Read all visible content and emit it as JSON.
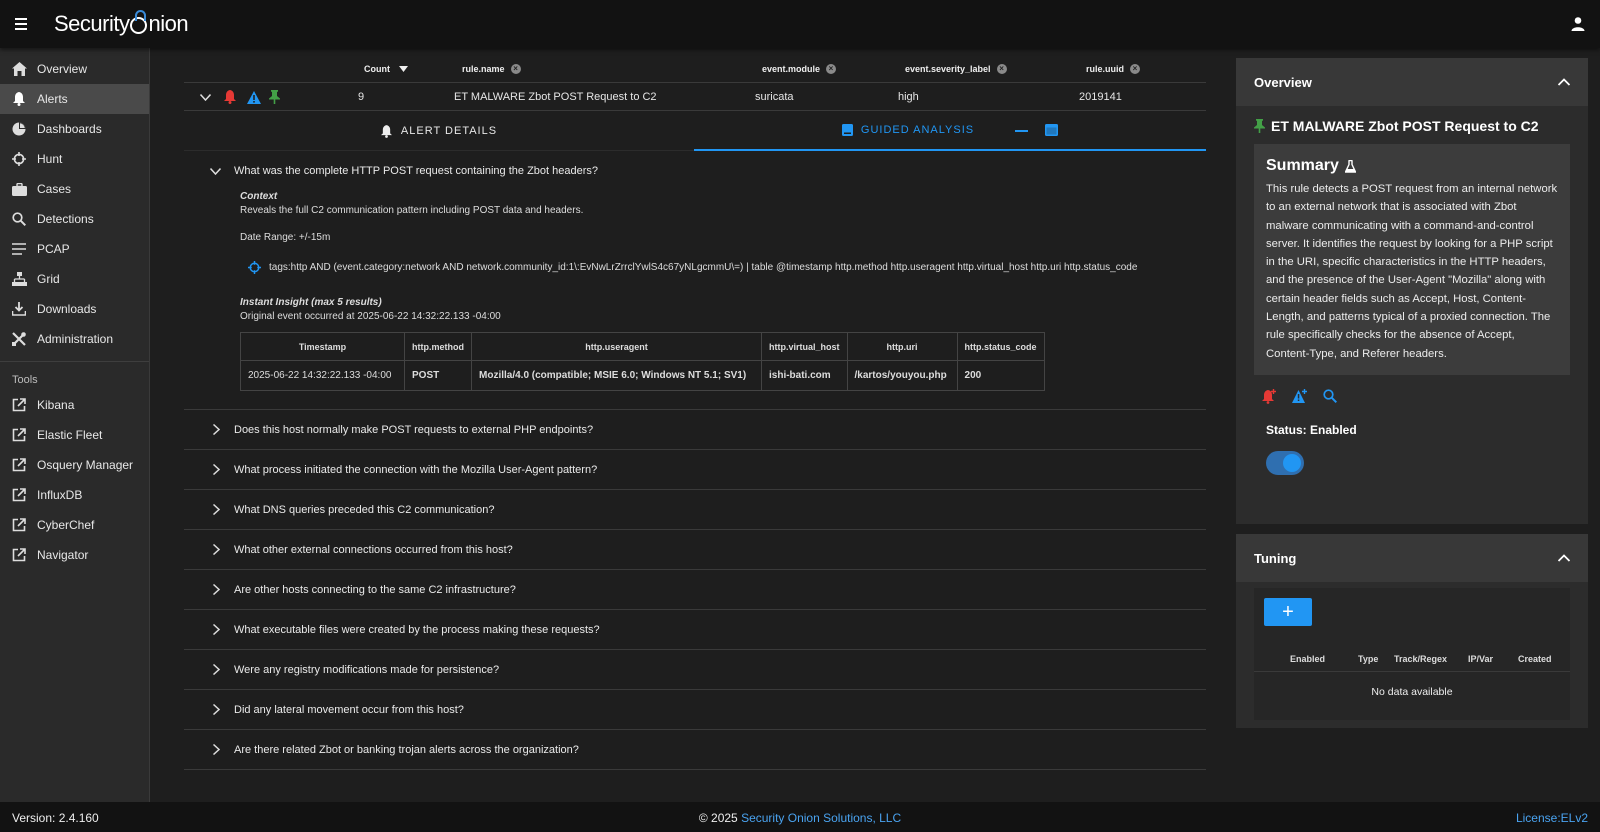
{
  "app": {
    "logo_part1": "Security",
    "logo_part2": "nion"
  },
  "sidebar": {
    "items": [
      {
        "label": "Overview",
        "icon": "home-icon"
      },
      {
        "label": "Alerts",
        "icon": "bell-icon",
        "active": true
      },
      {
        "label": "Dashboards",
        "icon": "pie-chart-icon"
      },
      {
        "label": "Hunt",
        "icon": "crosshair-icon"
      },
      {
        "label": "Cases",
        "icon": "briefcase-icon"
      },
      {
        "label": "Detections",
        "icon": "search-icon"
      },
      {
        "label": "PCAP",
        "icon": "lines-icon"
      },
      {
        "label": "Grid",
        "icon": "grid-icon"
      },
      {
        "label": "Downloads",
        "icon": "download-icon"
      },
      {
        "label": "Administration",
        "icon": "tools-icon"
      }
    ],
    "tools_label": "Tools",
    "tools": [
      {
        "label": "Kibana"
      },
      {
        "label": "Elastic Fleet"
      },
      {
        "label": "Osquery Manager"
      },
      {
        "label": "InfluxDB"
      },
      {
        "label": "CyberChef"
      },
      {
        "label": "Navigator"
      }
    ]
  },
  "alerts_table": {
    "headers": {
      "count": "Count",
      "rule_name": "rule.name",
      "event_module": "event.module",
      "severity": "event.severity_label",
      "uuid": "rule.uuid"
    },
    "row": {
      "count": "9",
      "rule_name": "ET MALWARE Zbot POST Request to C2",
      "event_module": "suricata",
      "severity": "high",
      "uuid": "2019141"
    }
  },
  "tabs": {
    "alert_details": "ALERT DETAILS",
    "guided_analysis": "GUIDED ANALYSIS"
  },
  "guided": {
    "open_question": "What was the complete HTTP POST request containing the Zbot headers?",
    "context_title": "Context",
    "context_text": "Reveals the full C2 communication pattern including POST data and headers.",
    "date_range": "Date Range: +/-15m",
    "query": "tags:http AND (event.category:network AND network.community_id:1\\:EvNwLrZrrclYwlS4c67yNLgcmmU\\=) | table @timestamp http.method http.useragent http.virtual_host http.uri http.status_code",
    "insight_title": "Instant Insight (max 5 results)",
    "insight_subtitle": "Original event occurred at 2025-06-22 14:32:22.133 -04:00",
    "insight_headers": [
      "Timestamp",
      "http.method",
      "http.useragent",
      "http.virtual_host",
      "http.uri",
      "http.status_code"
    ],
    "insight_row": [
      "2025-06-22 14:32:22.133 -04:00",
      "POST",
      "Mozilla/4.0 (compatible; MSIE 6.0; Windows NT 5.1; SV1)",
      "ishi-bati.com",
      "/kartos/youyou.php",
      "200"
    ],
    "questions": [
      "Does this host normally make POST requests to external PHP endpoints?",
      "What process initiated the connection with the Mozilla User-Agent pattern?",
      "What DNS queries preceded this C2 communication?",
      "What other external connections occurred from this host?",
      "Are other hosts connecting to the same C2 infrastructure?",
      "What executable files were created by the process making these requests?",
      "Were any registry modifications made for persistence?",
      "Did any lateral movement occur from this host?",
      "Are there related Zbot or banking trojan alerts across the organization?"
    ]
  },
  "overview_panel": {
    "title": "Overview",
    "rule_title": "ET MALWARE Zbot POST Request to C2",
    "summary_title": "Summary",
    "summary_text": "This rule detects a POST request from an internal network to an external network that is associated with Zbot malware communicating with a command-and-control server. It identifies the request by looking for a PHP script in the URI, specific characteristics in the HTTP headers, and the presence of the User-Agent \"Mozilla\" along with certain header fields such as Accept, Host, Content-Length, and patterns typical of a proxied connection. The rule specifically checks for the absence of Accept, Content-Type, and Referer headers.",
    "status": "Status: Enabled",
    "enabled": true
  },
  "tuning_panel": {
    "title": "Tuning",
    "add_label": "+",
    "columns": [
      "Enabled",
      "Type",
      "Track/Regex",
      "IP/Var",
      "Created"
    ],
    "empty": "No data available"
  },
  "footer": {
    "version": "Version: 2.4.160",
    "copyright_prefix": "© 2025",
    "company": "Security Onion Solutions, LLC",
    "license": "License:ELv2"
  },
  "colors": {
    "accent": "#2196f3",
    "alert_red": "#e53935",
    "pin_green": "#43a047"
  }
}
